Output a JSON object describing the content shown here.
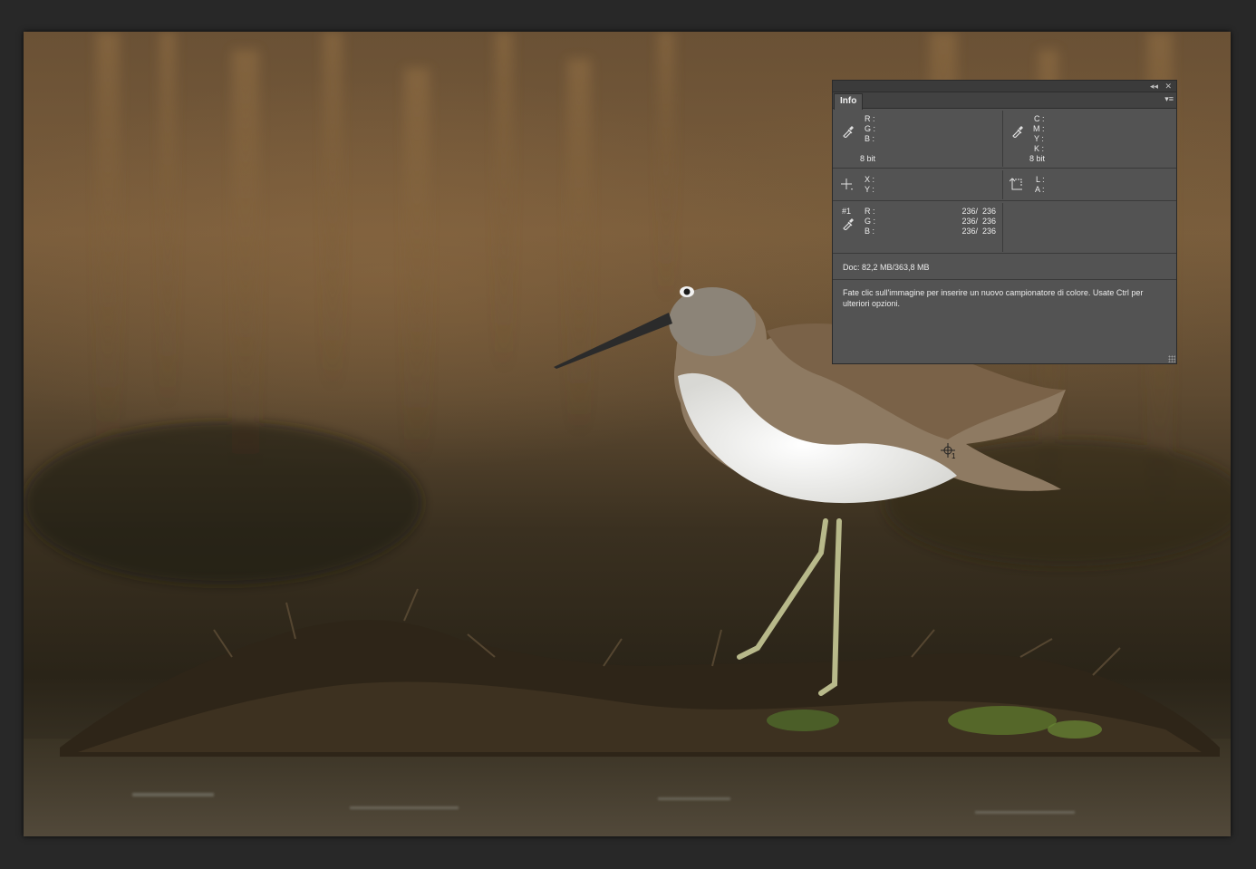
{
  "app": {
    "workspace_bg": "#282828",
    "panel_bg": "#535353"
  },
  "canvas": {
    "subject": "photo"
  },
  "info_panel": {
    "tab_label": "Info",
    "topbar": {
      "collapse_icon": "double-chevron-left-icon",
      "close_icon": "close-icon"
    },
    "panel_menu_icon": "panel-menu-icon",
    "rgb_section": {
      "labels": [
        "R :",
        "G :",
        "B :"
      ],
      "bit_depth": "8 bit"
    },
    "cmyk_section": {
      "labels": [
        "C :",
        "M :",
        "Y :",
        "K :"
      ],
      "bit_depth": "8 bit"
    },
    "xy_section": {
      "labels": [
        "X :",
        "Y :"
      ]
    },
    "size_section": {
      "labels": [
        "L :",
        "A :"
      ]
    },
    "sampler_section": {
      "sampler_id": "#1",
      "rows": [
        {
          "label": "R :",
          "value": "236/  236"
        },
        {
          "label": "G :",
          "value": "236/  236"
        },
        {
          "label": "B :",
          "value": "236/  236"
        }
      ]
    },
    "doc_info": "Doc: 82,2 MB/363,8 MB",
    "message": "Fate clic sull'immagine per inserire un  nuovo campionatore di colore. Usate Ctrl per ulteriori opzioni."
  },
  "sampler_marker": {
    "label": "1"
  }
}
